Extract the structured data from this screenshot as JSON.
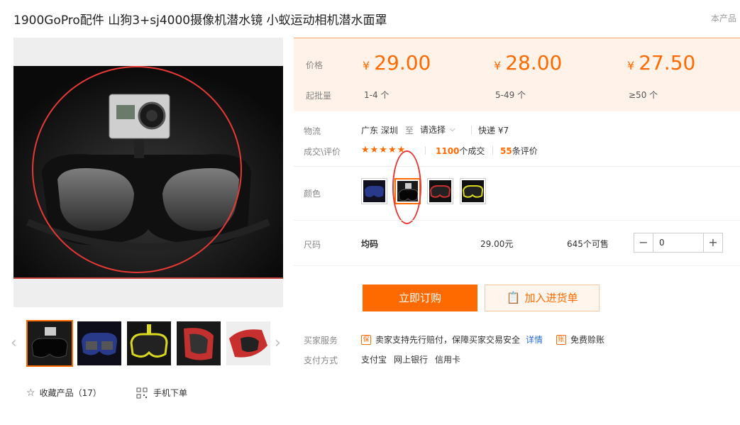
{
  "title": "1900GoPro配件 山狗3+sj4000摄像机潜水镜 小蚁运动相机潜水面罩",
  "notice": "本产品",
  "price_section": {
    "price_label": "价格",
    "moq_label": "起批量",
    "tiers": [
      {
        "currency": "¥",
        "price": "29.00",
        "range": "1-4 个"
      },
      {
        "currency": "¥",
        "price": "28.00",
        "range": "5-49 个"
      },
      {
        "currency": "¥",
        "price": "27.50",
        "range": "≥50 个"
      }
    ]
  },
  "logistics": {
    "label": "物流",
    "origin": "广东 深圳",
    "to": "至",
    "destination_placeholder": "请选择",
    "shipping": "快递 ¥7"
  },
  "reviews": {
    "label": "成交\\评价",
    "stars": "★★★★★",
    "deals_count": "1100",
    "deals_unit": "个成交",
    "reviews_count": "55",
    "reviews_unit": "条评价"
  },
  "color": {
    "label": "颜色",
    "options": [
      "black-blue",
      "black-camera",
      "black-red",
      "black-yellow"
    ],
    "selected": 1
  },
  "size": {
    "label": "尺码",
    "value": "均码",
    "price": "29.00元",
    "stock": "645个可售",
    "qty": "0",
    "minus": "−",
    "plus": "+"
  },
  "actions": {
    "buy": "立即订购",
    "cart": "加入进货单"
  },
  "service": {
    "label": "买家服务",
    "item1": "卖家支持先行赔付，保障买家交易安全",
    "detail_link": "详情",
    "item2": "免费赊账",
    "icon1": "保",
    "icon2": "账"
  },
  "payment": {
    "label": "支付方式",
    "methods": [
      "支付宝",
      "网上银行",
      "信用卡"
    ]
  },
  "footer": {
    "favorite": "收藏产品（17）",
    "mobile": "手机下单"
  },
  "colors": {
    "accent": "#ff6a00",
    "price_bg": "#fff2e8",
    "annotation": "#e53935"
  }
}
